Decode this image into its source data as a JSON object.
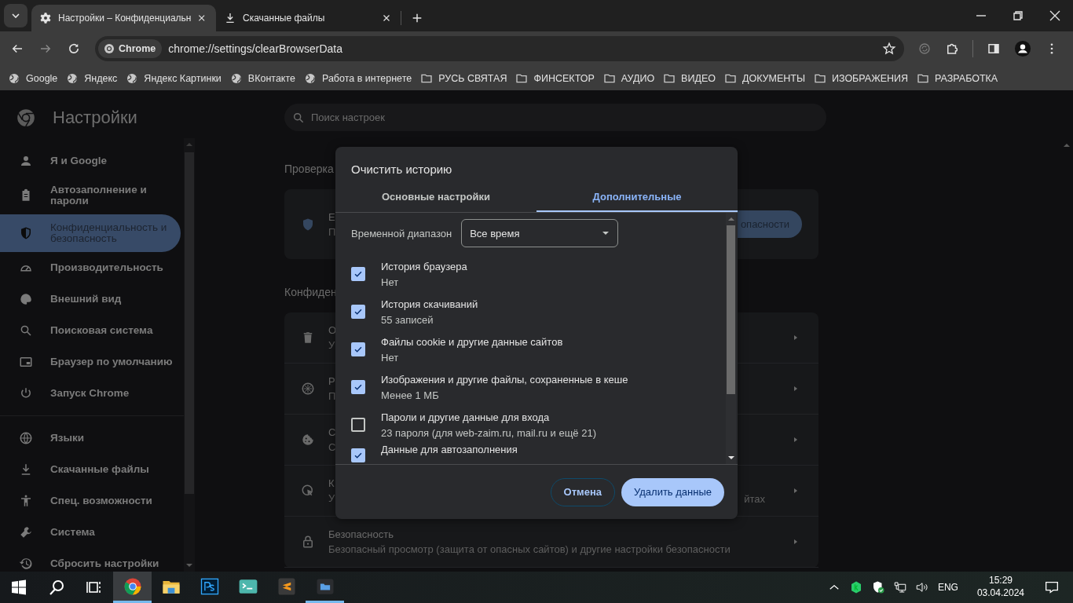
{
  "browser": {
    "tabs": [
      {
        "title": "Настройки – Конфиденциальн",
        "selected": true
      },
      {
        "title": "Скачанные файлы",
        "selected": false
      }
    ],
    "chip": "Chrome",
    "url": "chrome://settings/clearBrowserData",
    "bookmarks": [
      {
        "label": "Google",
        "kind": "site"
      },
      {
        "label": "Яндекс",
        "kind": "site"
      },
      {
        "label": "Яндекс Картинки",
        "kind": "site"
      },
      {
        "label": "ВКонтакте",
        "kind": "site"
      },
      {
        "label": "Работа в интернете",
        "kind": "site"
      },
      {
        "label": "РУСЬ СВЯТАЯ",
        "kind": "folder"
      },
      {
        "label": "ФИНСЕКТОР",
        "kind": "folder"
      },
      {
        "label": "АУДИО",
        "kind": "folder"
      },
      {
        "label": "ВИДЕО",
        "kind": "folder"
      },
      {
        "label": "ДОКУМЕНТЫ",
        "kind": "folder"
      },
      {
        "label": "ИЗОБРАЖЕНИЯ",
        "kind": "folder"
      },
      {
        "label": "РАЗРАБОТКА",
        "kind": "folder"
      }
    ]
  },
  "settings": {
    "title": "Настройки",
    "search_placeholder": "Поиск настроек",
    "sidebar": [
      [
        {
          "label": "Я и Google",
          "selected": false
        },
        {
          "label": "Автозаполнение и пароли",
          "selected": false
        },
        {
          "label": "Конфиденциальность и безопасность",
          "selected": true
        },
        {
          "label": "Производительность",
          "selected": false
        },
        {
          "label": "Внешний вид",
          "selected": false
        },
        {
          "label": "Поисковая система",
          "selected": false
        },
        {
          "label": "Браузер по умолчанию",
          "selected": false
        },
        {
          "label": "Запуск Chrome",
          "selected": false
        }
      ],
      [
        {
          "label": "Языки",
          "selected": false
        },
        {
          "label": "Скачанные файлы",
          "selected": false
        },
        {
          "label": "Спец. возможности",
          "selected": false
        },
        {
          "label": "Система",
          "selected": false
        },
        {
          "label": "Сбросить настройки",
          "selected": false
        }
      ]
    ],
    "safety_heading": "Проверка",
    "safety_title": "Е",
    "safety_text": "П",
    "safety_button": "опасности",
    "privacy_heading": "Конфиден",
    "privacy_rows": [
      {
        "title": "О",
        "text": "У"
      },
      {
        "title": "Р",
        "text": "П"
      },
      {
        "title": "С",
        "text": "С"
      },
      {
        "title": "К",
        "text": "У",
        "text_end": "йтах"
      },
      {
        "title": "Безопасность",
        "text": "Безопасный просмотр (защита от опасных сайтов) и другие настройки безопасности"
      }
    ]
  },
  "dialog": {
    "title": "Очистить историю",
    "tabs": [
      {
        "label": "Основные настройки",
        "selected": false
      },
      {
        "label": "Дополнительные",
        "selected": true
      }
    ],
    "range_label": "Временной диапазон",
    "range_value": "Все время",
    "items": [
      {
        "title": "История браузера",
        "detail": "Нет",
        "checked": true
      },
      {
        "title": "История скачиваний",
        "detail": "55 записей",
        "checked": true
      },
      {
        "title": "Файлы cookie и другие данные сайтов",
        "detail": "Нет",
        "checked": true
      },
      {
        "title": "Изображения и другие файлы, сохраненные в кеше",
        "detail": "Менее 1 МБ",
        "checked": true
      },
      {
        "title": "Пароли и другие данные для входа",
        "detail": "23 пароля (для web-zaim.ru, mail.ru и ещё 21)",
        "checked": false
      },
      {
        "title": "Данные для автозаполнения",
        "checked": true
      }
    ],
    "cancel": "Отмена",
    "confirm": "Удалить данные"
  },
  "taskbar": {
    "apps": [
      {
        "selected": true,
        "running": true
      },
      {
        "selected": false,
        "running": false
      },
      {
        "selected": false,
        "running": false
      },
      {
        "selected": false,
        "running": false
      },
      {
        "selected": false,
        "running": false
      },
      {
        "selected": false,
        "running": true
      }
    ],
    "language": "ENG",
    "time": "15:29",
    "date": "03.04.2024"
  }
}
